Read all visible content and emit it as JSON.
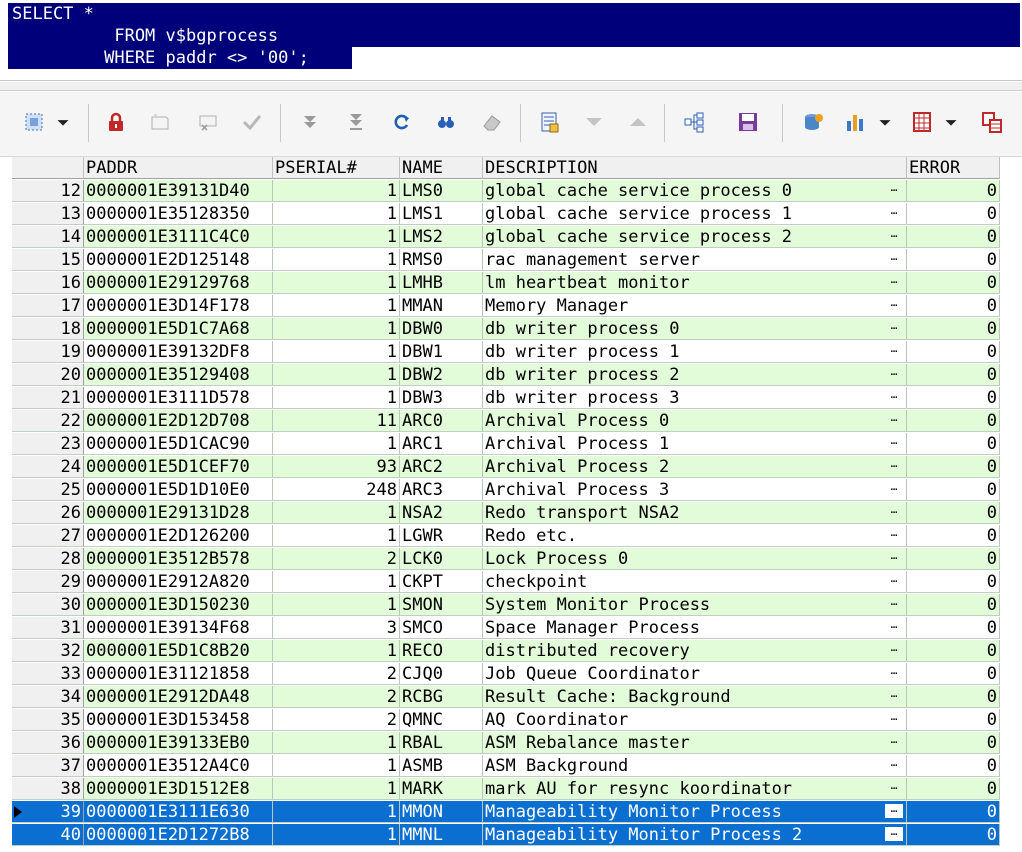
{
  "editor": {
    "sql_lines": [
      "SELECT *",
      "          FROM v$bgprocess",
      "         WHERE paddr <> '00';"
    ]
  },
  "toolbar": {
    "icons": [
      "select-icon",
      "dropdown-icon",
      "lock-icon",
      "new-record-icon",
      "delete-record-icon",
      "post-icon",
      "first-icon",
      "last-icon",
      "refresh-icon",
      "find-icon",
      "clear-icon",
      "form-view-icon",
      "down-icon",
      "up-icon",
      "tree-icon",
      "save-icon",
      "export-db-icon",
      "chart-icon",
      "grid-icon",
      "compare-icon"
    ]
  },
  "grid": {
    "columns": [
      "PADDR",
      "PSERIAL#",
      "NAME",
      "DESCRIPTION",
      "ERROR"
    ],
    "rows": [
      {
        "n": "12",
        "paddr": "0000001E39131D40",
        "pserial": "1",
        "name": "LMS0",
        "desc": "global cache service process 0",
        "error": "0"
      },
      {
        "n": "13",
        "paddr": "0000001E35128350",
        "pserial": "1",
        "name": "LMS1",
        "desc": "global cache service process 1",
        "error": "0"
      },
      {
        "n": "14",
        "paddr": "0000001E3111C4C0",
        "pserial": "1",
        "name": "LMS2",
        "desc": "global cache service process 2",
        "error": "0"
      },
      {
        "n": "15",
        "paddr": "0000001E2D125148",
        "pserial": "1",
        "name": "RMS0",
        "desc": "rac management server",
        "error": "0"
      },
      {
        "n": "16",
        "paddr": "0000001E29129768",
        "pserial": "1",
        "name": "LMHB",
        "desc": "lm heartbeat monitor",
        "error": "0"
      },
      {
        "n": "17",
        "paddr": "0000001E3D14F178",
        "pserial": "1",
        "name": "MMAN",
        "desc": "Memory Manager",
        "error": "0"
      },
      {
        "n": "18",
        "paddr": "0000001E5D1C7A68",
        "pserial": "1",
        "name": "DBW0",
        "desc": "db writer process 0",
        "error": "0"
      },
      {
        "n": "19",
        "paddr": "0000001E39132DF8",
        "pserial": "1",
        "name": "DBW1",
        "desc": "db writer process 1",
        "error": "0"
      },
      {
        "n": "20",
        "paddr": "0000001E35129408",
        "pserial": "1",
        "name": "DBW2",
        "desc": "db writer process 2",
        "error": "0"
      },
      {
        "n": "21",
        "paddr": "0000001E3111D578",
        "pserial": "1",
        "name": "DBW3",
        "desc": "db writer process 3",
        "error": "0"
      },
      {
        "n": "22",
        "paddr": "0000001E2D12D708",
        "pserial": "11",
        "name": "ARC0",
        "desc": "Archival Process 0",
        "error": "0"
      },
      {
        "n": "23",
        "paddr": "0000001E5D1CAC90",
        "pserial": "1",
        "name": "ARC1",
        "desc": "Archival Process 1",
        "error": "0"
      },
      {
        "n": "24",
        "paddr": "0000001E5D1CEF70",
        "pserial": "93",
        "name": "ARC2",
        "desc": "Archival Process 2",
        "error": "0"
      },
      {
        "n": "25",
        "paddr": "0000001E5D1D10E0",
        "pserial": "248",
        "name": "ARC3",
        "desc": "Archival Process 3",
        "error": "0"
      },
      {
        "n": "26",
        "paddr": "0000001E29131D28",
        "pserial": "1",
        "name": "NSA2",
        "desc": "Redo transport NSA2",
        "error": "0"
      },
      {
        "n": "27",
        "paddr": "0000001E2D126200",
        "pserial": "1",
        "name": "LGWR",
        "desc": "Redo etc.",
        "error": "0"
      },
      {
        "n": "28",
        "paddr": "0000001E3512B578",
        "pserial": "2",
        "name": "LCK0",
        "desc": "Lock Process 0",
        "error": "0"
      },
      {
        "n": "29",
        "paddr": "0000001E2912A820",
        "pserial": "1",
        "name": "CKPT",
        "desc": "checkpoint",
        "error": "0"
      },
      {
        "n": "30",
        "paddr": "0000001E3D150230",
        "pserial": "1",
        "name": "SMON",
        "desc": "System Monitor Process",
        "error": "0"
      },
      {
        "n": "31",
        "paddr": "0000001E39134F68",
        "pserial": "3",
        "name": "SMCO",
        "desc": "Space Manager Process",
        "error": "0"
      },
      {
        "n": "32",
        "paddr": "0000001E5D1C8B20",
        "pserial": "1",
        "name": "RECO",
        "desc": "distributed recovery",
        "error": "0"
      },
      {
        "n": "33",
        "paddr": "0000001E31121858",
        "pserial": "2",
        "name": "CJQ0",
        "desc": "Job Queue Coordinator",
        "error": "0"
      },
      {
        "n": "34",
        "paddr": "0000001E2912DA48",
        "pserial": "2",
        "name": "RCBG",
        "desc": "Result Cache: Background",
        "error": "0"
      },
      {
        "n": "35",
        "paddr": "0000001E3D153458",
        "pserial": "2",
        "name": "QMNC",
        "desc": "AQ Coordinator",
        "error": "0"
      },
      {
        "n": "36",
        "paddr": "0000001E39133EB0",
        "pserial": "1",
        "name": "RBAL",
        "desc": "ASM Rebalance master",
        "error": "0"
      },
      {
        "n": "37",
        "paddr": "0000001E3512A4C0",
        "pserial": "1",
        "name": "ASMB",
        "desc": "ASM Background",
        "error": "0"
      },
      {
        "n": "38",
        "paddr": "0000001E3D1512E8",
        "pserial": "1",
        "name": "MARK",
        "desc": "mark AU for resync koordinator",
        "error": "0"
      },
      {
        "n": "39",
        "paddr": "0000001E3111E630",
        "pserial": "1",
        "name": "MMON",
        "desc": "Manageability Monitor Process",
        "error": "0"
      },
      {
        "n": "40",
        "paddr": "0000001E2D1272B8",
        "pserial": "1",
        "name": "MMNL",
        "desc": "Manageability Monitor Process 2",
        "error": "0"
      }
    ],
    "selected_rows": [
      "39",
      "40"
    ],
    "current_row": "39"
  },
  "colors": {
    "editor_selection": "#00007a",
    "row_alt": "#e2fbd8",
    "row_selected": "#0a6fd0"
  }
}
